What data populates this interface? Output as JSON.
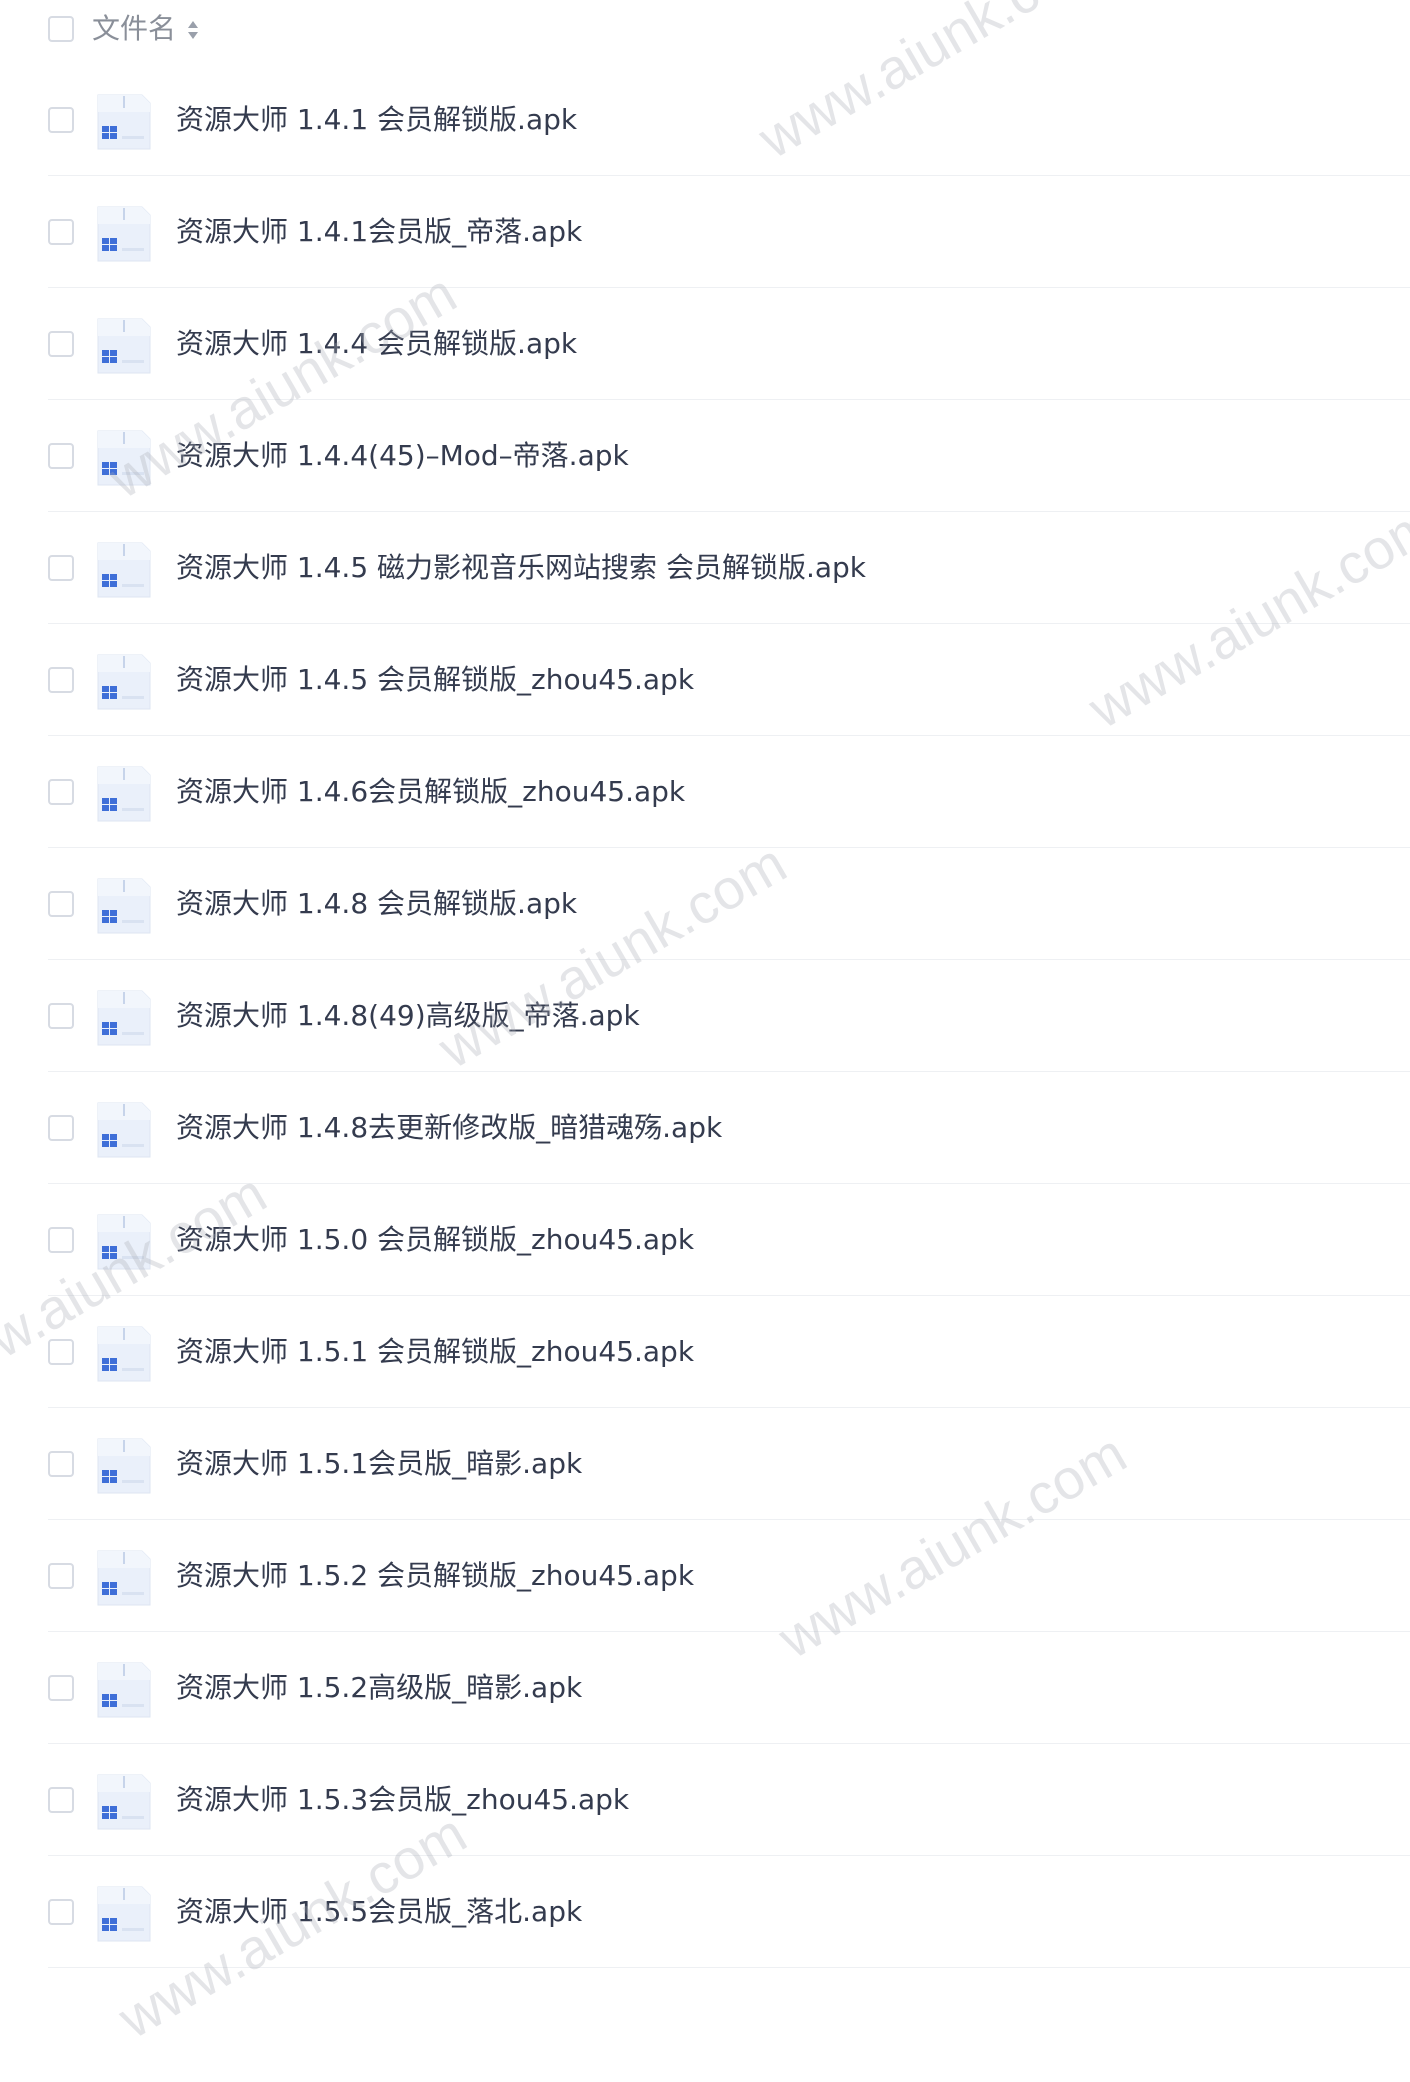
{
  "header": {
    "column_label": "文件名"
  },
  "files": [
    {
      "name": "资源大师 1.4.1 会员解锁版.apk"
    },
    {
      "name": "资源大师 1.4.1会员版_帝落.apk"
    },
    {
      "name": "资源大师 1.4.4 会员解锁版.apk"
    },
    {
      "name": "资源大师 1.4.4(45)–Mod–帝落.apk"
    },
    {
      "name": "资源大师 1.4.5 磁力影视音乐网站搜索 会员解锁版.apk"
    },
    {
      "name": "资源大师 1.4.5 会员解锁版_zhou45.apk"
    },
    {
      "name": "资源大师 1.4.6会员解锁版_zhou45.apk"
    },
    {
      "name": "资源大师 1.4.8 会员解锁版.apk"
    },
    {
      "name": "资源大师 1.4.8(49)高级版_帝落.apk"
    },
    {
      "name": "资源大师 1.4.8去更新修改版_暗猎魂殇.apk"
    },
    {
      "name": "资源大师 1.5.0 会员解锁版_zhou45.apk"
    },
    {
      "name": "资源大师 1.5.1 会员解锁版_zhou45.apk"
    },
    {
      "name": "资源大师 1.5.1会员版_暗影.apk"
    },
    {
      "name": "资源大师 1.5.2 会员解锁版_zhou45.apk"
    },
    {
      "name": "资源大师 1.5.2高级版_暗影.apk"
    },
    {
      "name": "资源大师 1.5.3会员版_zhou45.apk"
    },
    {
      "name": "资源大师 1.5.5会员版_落北.apk"
    }
  ],
  "watermark": {
    "text": "www.aiunk.com"
  },
  "icons": {
    "file": "apk-file-icon",
    "sort": "sort-icon"
  },
  "colors": {
    "text": "#343b4e",
    "header_text": "#8a8f99",
    "checkbox_border": "#d7dbe3",
    "divider": "#eef0f3",
    "icon_body": "#eef3fb",
    "icon_accent": "#3f6fd8"
  }
}
